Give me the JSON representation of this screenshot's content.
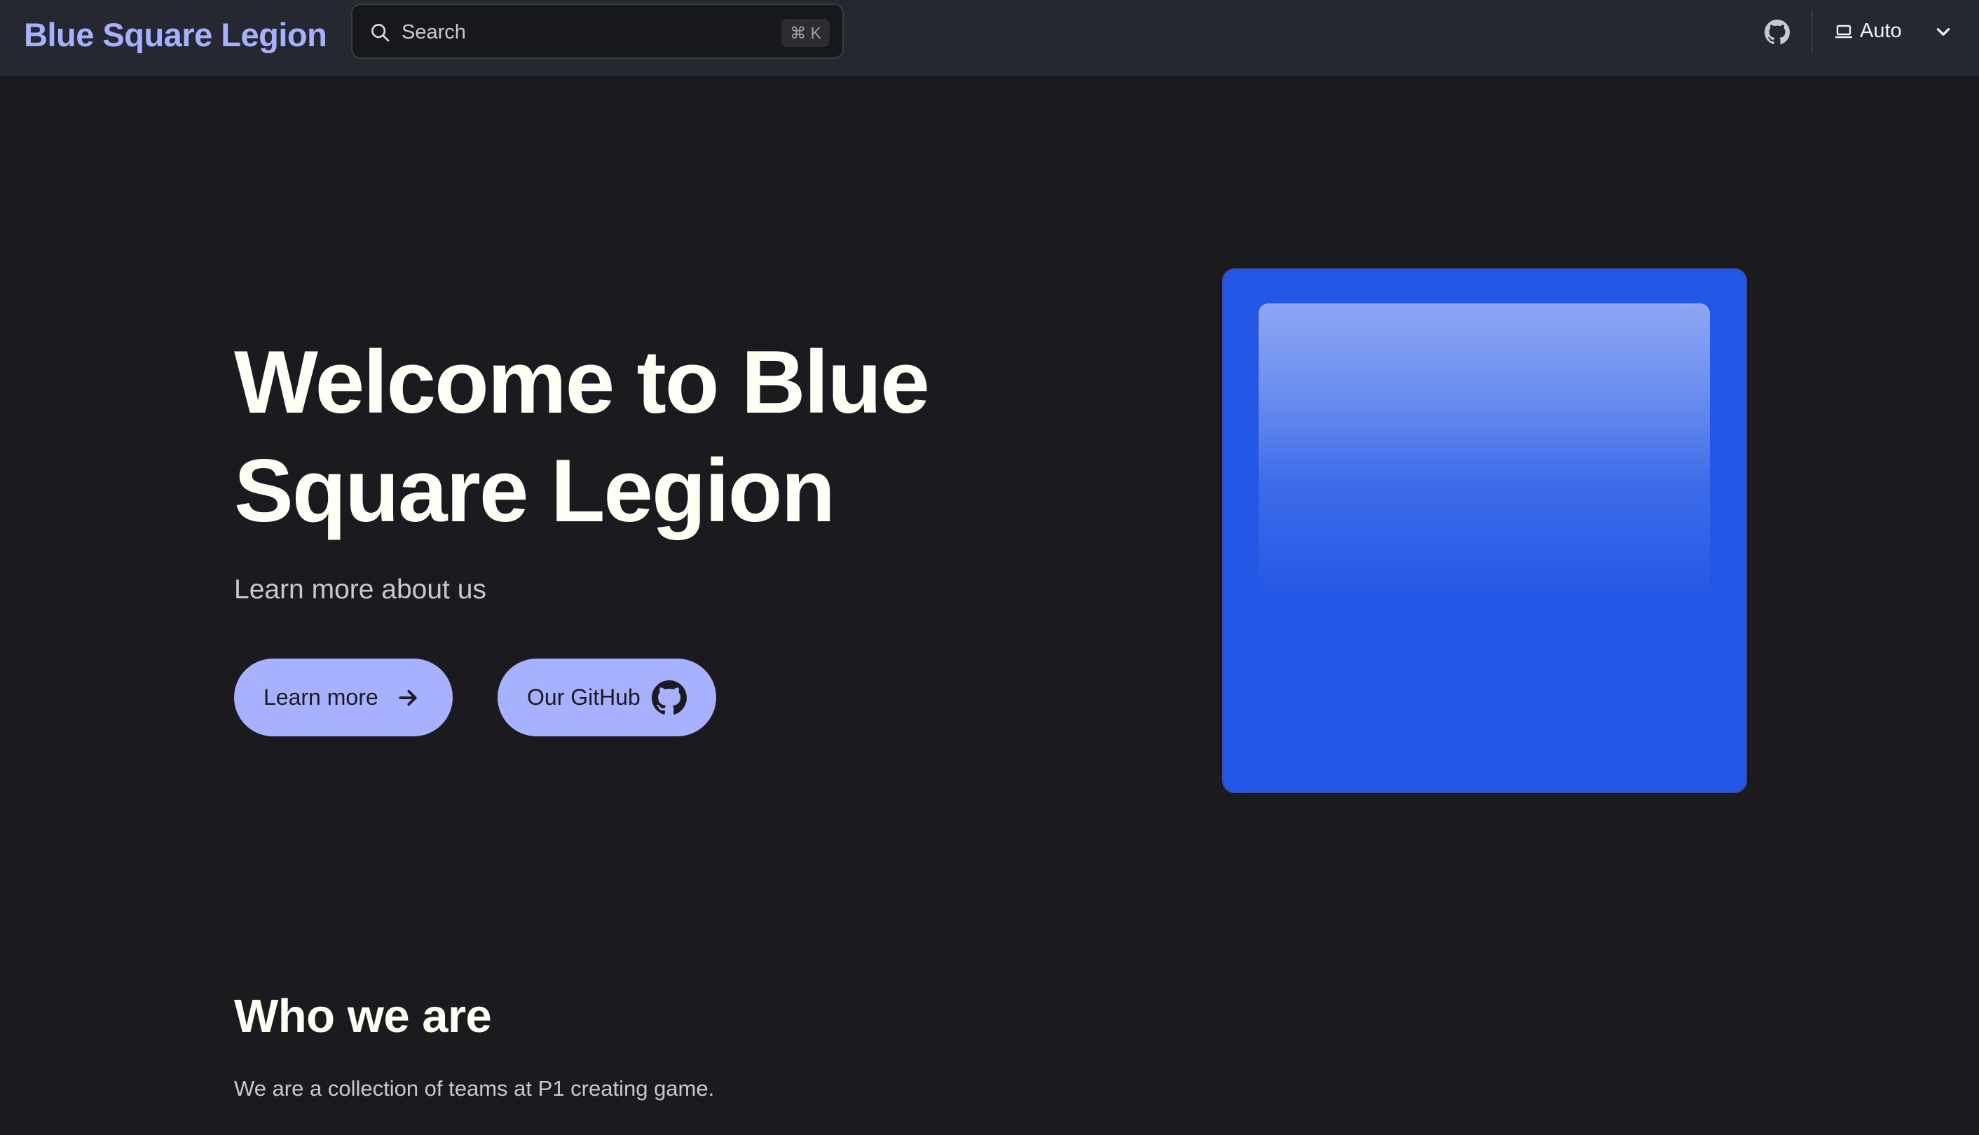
{
  "nav": {
    "site_title": "Blue Square Legion",
    "search": {
      "placeholder": "Search",
      "shortcut": "⌘ K"
    },
    "github_icon": "github-icon",
    "theme": {
      "icon": "laptop-icon",
      "label": "Auto",
      "dropdown_icon": "chevron-down-icon"
    }
  },
  "hero": {
    "title": "Welcome to Blue Square Legion",
    "subtitle": "Learn more about us",
    "buttons": [
      {
        "label": "Learn more",
        "icon": "arrow-right-icon"
      },
      {
        "label": "Our GitHub",
        "icon": "github-icon"
      }
    ],
    "image": "blue-square-image"
  },
  "section": {
    "title": "Who we are",
    "text": "We are a collection of teams at P1 creating game."
  },
  "colors": {
    "background": "#1b1b1f",
    "navbar": "#252830",
    "accent": "#a8b1ff",
    "square": "#2557e6"
  }
}
